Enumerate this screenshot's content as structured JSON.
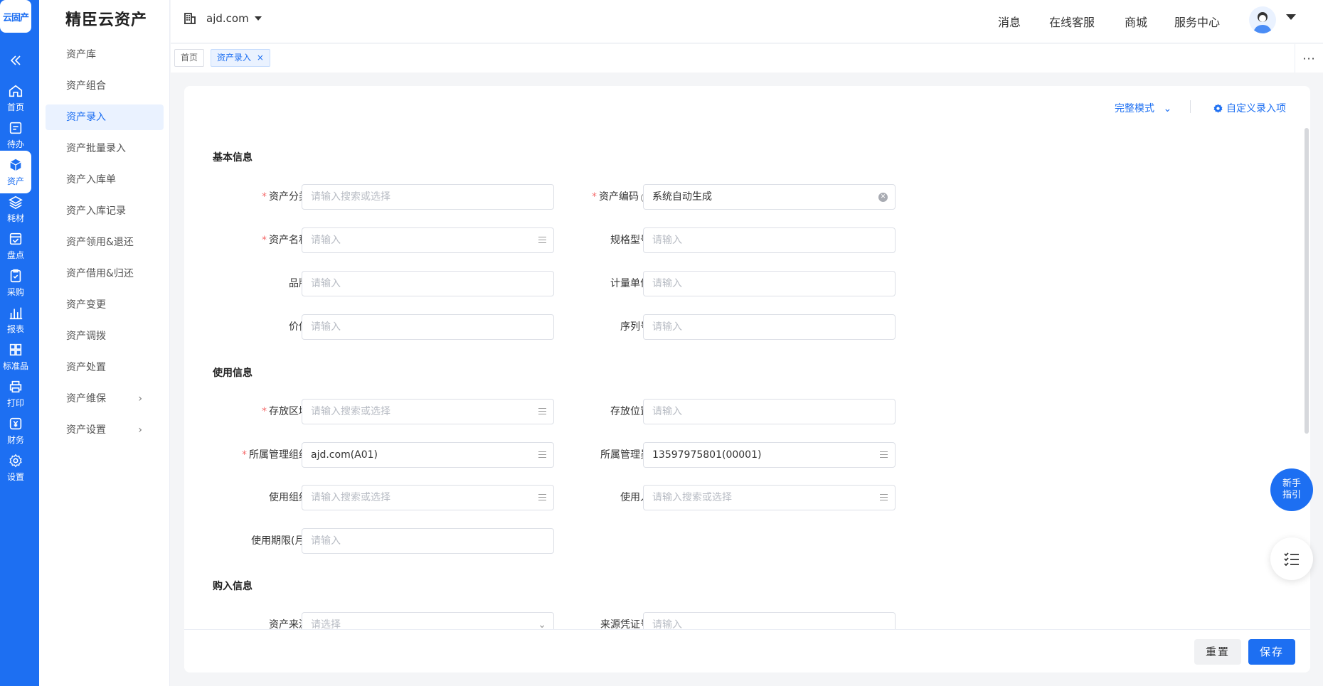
{
  "rail": {
    "logo": "云固产",
    "items": [
      {
        "label": "首页",
        "icon": "home-icon"
      },
      {
        "label": "待办",
        "icon": "todo-icon"
      },
      {
        "label": "资产",
        "icon": "cube-icon"
      },
      {
        "label": "耗材",
        "icon": "layers-icon"
      },
      {
        "label": "盘点",
        "icon": "check-calendar-icon"
      },
      {
        "label": "采购",
        "icon": "clipboard-check-icon"
      },
      {
        "label": "报表",
        "icon": "bar-chart-icon"
      },
      {
        "label": "标准品",
        "icon": "grid-icon"
      },
      {
        "label": "打印",
        "icon": "printer-icon"
      },
      {
        "label": "财务",
        "icon": "yen-icon"
      },
      {
        "label": "设置",
        "icon": "gear-icon"
      }
    ]
  },
  "submenu": {
    "brand": "精臣云资产",
    "items": [
      {
        "label": "资产库"
      },
      {
        "label": "资产组合"
      },
      {
        "label": "资产录入"
      },
      {
        "label": "资产批量录入"
      },
      {
        "label": "资产入库单"
      },
      {
        "label": "资产入库记录"
      },
      {
        "label": "资产领用&退还"
      },
      {
        "label": "资产借用&归还"
      },
      {
        "label": "资产变更"
      },
      {
        "label": "资产调拨"
      },
      {
        "label": "资产处置"
      },
      {
        "label": "资产维保"
      },
      {
        "label": "资产设置"
      }
    ]
  },
  "topbar": {
    "domain": "ajd.com",
    "nav": [
      "消息",
      "在线客服",
      "商城",
      "服务中心"
    ]
  },
  "tabs": {
    "home": "首页",
    "current": "资产录入",
    "more": "···"
  },
  "toolbar": {
    "mode": "完整模式",
    "custom": "自定义录入项"
  },
  "sections": {
    "basic": "基本信息",
    "usage": "使用信息",
    "purchase": "购入信息"
  },
  "fields": {
    "category": {
      "label": "资产分类",
      "placeholder": "请输入搜索或选择"
    },
    "code": {
      "label": "资产编码",
      "value": "系统自动生成"
    },
    "name": {
      "label": "资产名称",
      "placeholder": "请输入"
    },
    "spec": {
      "label": "规格型号",
      "placeholder": "请输入"
    },
    "brand": {
      "label": "品牌",
      "placeholder": "请输入"
    },
    "unit": {
      "label": "计量单位",
      "placeholder": "请输入"
    },
    "value": {
      "label": "价值",
      "placeholder": "请输入"
    },
    "serial": {
      "label": "序列号",
      "placeholder": "请输入"
    },
    "area": {
      "label": "存放区域",
      "placeholder": "请输入搜索或选择"
    },
    "location": {
      "label": "存放位置",
      "placeholder": "请输入"
    },
    "org": {
      "label": "所属管理组织",
      "value": "ajd.com(A01)"
    },
    "admin": {
      "label": "所属管理员",
      "value": "13597975801(00001)"
    },
    "use_org": {
      "label": "使用组织",
      "placeholder": "请输入搜索或选择"
    },
    "user": {
      "label": "使用人",
      "placeholder": "请输入搜索或选择"
    },
    "period": {
      "label": "使用期限(月)",
      "placeholder": "请输入"
    },
    "source": {
      "label": "资产来源",
      "placeholder": "请选择"
    },
    "voucher": {
      "label": "来源凭证号",
      "placeholder": "请输入"
    }
  },
  "footer": {
    "reset": "重置",
    "save": "保存"
  },
  "floating": {
    "guide": "新手指引"
  },
  "colors": {
    "primary": "#1d6ff2",
    "required": "#f56c6c"
  }
}
